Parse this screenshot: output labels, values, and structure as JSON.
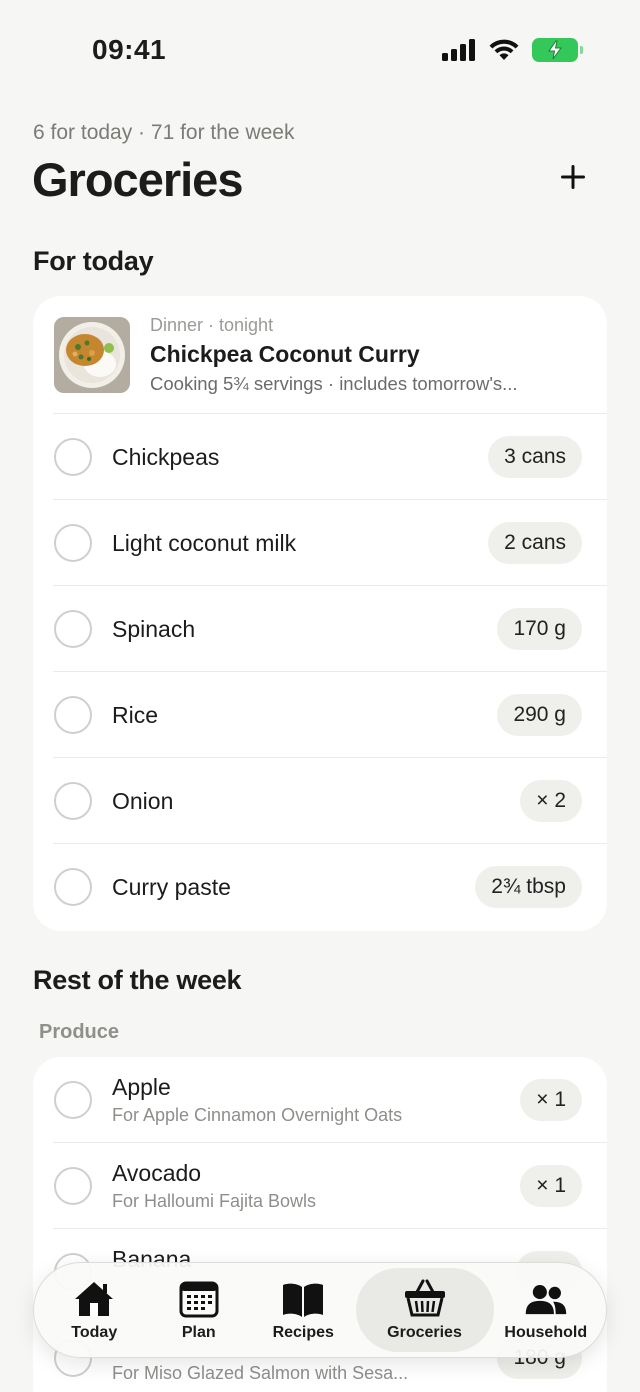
{
  "status": {
    "time": "09:41"
  },
  "header": {
    "summary": "6 for today · 71 for the week",
    "title": "Groceries"
  },
  "today": {
    "section_title": "For today",
    "meal": {
      "kicker": "Dinner · tonight",
      "title": "Chickpea Coconut Curry",
      "note": "Cooking 5¾ servings · includes tomorrow's..."
    },
    "items": [
      {
        "name": "Chickpeas",
        "qty": "3 cans"
      },
      {
        "name": "Light coconut milk",
        "qty": "2 cans"
      },
      {
        "name": "Spinach",
        "qty": "170 g"
      },
      {
        "name": "Rice",
        "qty": "290 g"
      },
      {
        "name": "Onion",
        "qty": "× 2"
      },
      {
        "name": "Curry paste",
        "qty": "2¾ tbsp"
      }
    ]
  },
  "week": {
    "section_title": "Rest of the week",
    "group": "Produce",
    "items": [
      {
        "name": "Apple",
        "for": "For Apple Cinnamon Overnight Oats",
        "qty": "× 1"
      },
      {
        "name": "Avocado",
        "for": "For Halloumi Fajita Bowls",
        "qty": "× 1"
      },
      {
        "name": "Banana",
        "for": "",
        "qty": ""
      },
      {
        "name": "",
        "for": "For Miso Glazed Salmon with Sesa...",
        "qty": "180 g"
      }
    ]
  },
  "tabs": [
    {
      "label": "Today",
      "icon": "house-icon"
    },
    {
      "label": "Plan",
      "icon": "calendar-icon"
    },
    {
      "label": "Recipes",
      "icon": "book-icon"
    },
    {
      "label": "Groceries",
      "icon": "basket-icon",
      "active": true
    },
    {
      "label": "Household",
      "icon": "people-icon"
    }
  ],
  "colors": {
    "battery": "#34c759",
    "background": "#f6f6f4"
  }
}
